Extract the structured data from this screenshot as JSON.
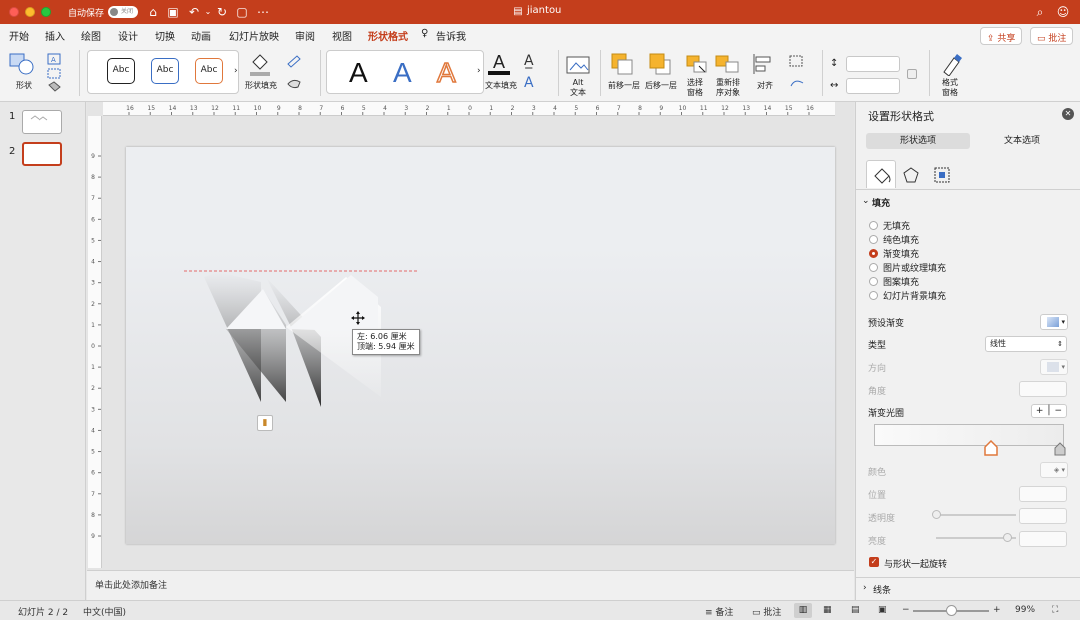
{
  "window": {
    "title": "jiantou",
    "autosave_label": "自动保存",
    "autosave_state": "关闭"
  },
  "menu_tabs": [
    "开始",
    "插入",
    "绘图",
    "设计",
    "切换",
    "动画",
    "幻灯片放映",
    "审阅",
    "视图",
    "形状格式",
    "告诉我"
  ],
  "active_tab": "形状格式",
  "header_buttons": {
    "share": "共享",
    "comments": "批注"
  },
  "ribbon": {
    "shape_label": "形状",
    "style_samples": [
      "Abc",
      "Abc",
      "Abc"
    ],
    "shape_fill_label": "形状填充",
    "wordart_samples": [
      "A",
      "A",
      "A"
    ],
    "text_fill_label": "文本填充",
    "alt_text_label": "Alt\n文本",
    "bring_forward": "前移一层",
    "send_backward": "后移一层",
    "selection_pane": "选择\n窗格",
    "reorder_objects": "重新排\n序对象",
    "align": "对齐",
    "format_pane": "格式\n窗格"
  },
  "thumbnails": [
    {
      "number": "1"
    },
    {
      "number": "2"
    }
  ],
  "ruler": {
    "h_ticks": [
      "16",
      "15",
      "14",
      "13",
      "12",
      "11",
      "10",
      "9",
      "8",
      "7",
      "6",
      "5",
      "4",
      "3",
      "2",
      "1",
      "0",
      "1",
      "2",
      "3",
      "4",
      "5",
      "6",
      "7",
      "8",
      "9",
      "10",
      "11",
      "12",
      "13",
      "14",
      "15",
      "16"
    ],
    "v_ticks": [
      "9",
      "8",
      "7",
      "6",
      "5",
      "4",
      "3",
      "2",
      "1",
      "0",
      "1",
      "2",
      "3",
      "4",
      "5",
      "6",
      "7",
      "8",
      "9"
    ]
  },
  "tooltip": {
    "line1": "左: 6.06 厘米",
    "line2": "顶端: 5.94 厘米"
  },
  "notes_placeholder": "单击此处添加备注",
  "format_pane": {
    "title": "设置形状格式",
    "tabs": [
      "形状选项",
      "文本选项"
    ],
    "section_fill": "填充",
    "fill_options": [
      "无填充",
      "纯色填充",
      "渐变填充",
      "图片或纹理填充",
      "图案填充",
      "幻灯片背景填充"
    ],
    "selected_fill": "渐变填充",
    "preset_gradient": "预设渐变",
    "type_label": "类型",
    "type_value": "线性",
    "direction": "方向",
    "angle": "角度",
    "gradient_stops": "渐变光圈",
    "color": "颜色",
    "position": "位置",
    "transparency": "透明度",
    "brightness": "亮度",
    "rotate_with_shape": "与形状一起旋转",
    "section_line": "线条"
  },
  "status": {
    "slide_indicator": "幻灯片 2 / 2",
    "language": "中文(中国)",
    "notes_btn": "备注",
    "comments_btn": "批注",
    "zoom": "99%"
  },
  "colors": {
    "accent": "#c43e1c"
  }
}
